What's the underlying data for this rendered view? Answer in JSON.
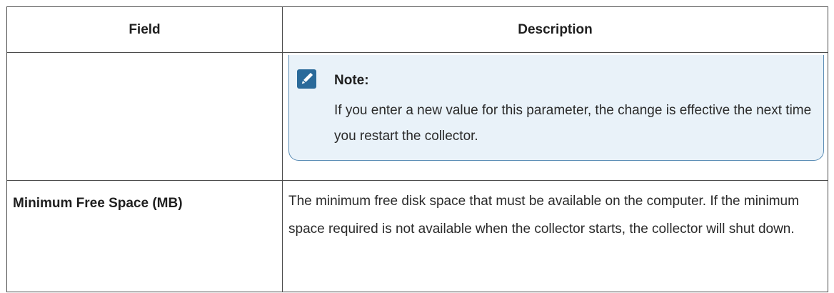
{
  "table": {
    "headers": {
      "field": "Field",
      "description": "Description"
    },
    "note": {
      "icon": "edit-pencil-icon",
      "title": "Note:",
      "body": "If you enter a new value for this parameter, the change is effective the next time you restart the collector."
    },
    "rows": [
      {
        "field": "Minimum Free Space (MB)",
        "description": "The minimum free disk space that must be available on the computer. If the minimum space required is not available when the collector starts, the collector will shut down."
      }
    ]
  },
  "colors": {
    "note_background": "#e9f2f9",
    "note_border": "#5b8db5",
    "icon_background": "#2a6a9a",
    "table_border": "#4a4a4a"
  }
}
